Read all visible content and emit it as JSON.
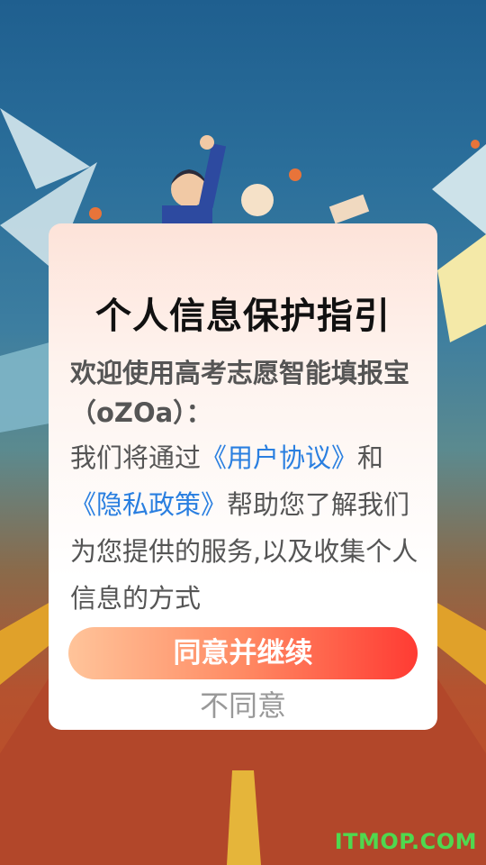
{
  "dialog": {
    "title": "个人信息保护指引",
    "greeting": "欢迎使用高考志愿智能填报宝 （oZOa）：",
    "body_prefix": "我们将通过",
    "user_agreement_link": "《用户协议》",
    "and_text": "和",
    "privacy_policy_link": "《隐私政策》",
    "body_suffix": "帮助您了解我们为您提供的服务,以及收集个人信息的方式",
    "agree_label": "同意并继续",
    "disagree_label": "不同意"
  },
  "watermark": "ITMOP.COM",
  "colors": {
    "link": "#2a7fe0",
    "agree_gradient_start": "#ffc49a",
    "agree_gradient_end": "#ff3b33",
    "watermark": "#4fd84f"
  }
}
